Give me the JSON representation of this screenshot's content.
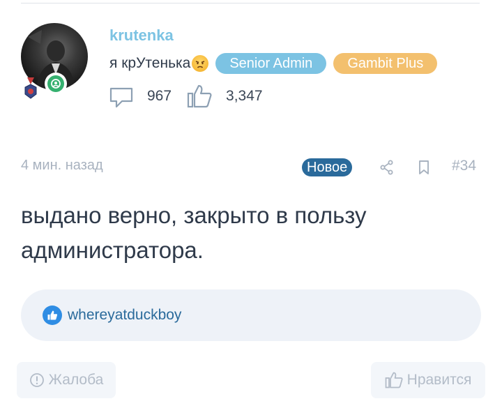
{
  "user": {
    "name": "krutenka",
    "status_text": "я крУтенька",
    "status_emoji": "angry-face-emoji",
    "badges": [
      {
        "label": "Senior Admin",
        "color": "#7cc3e3"
      },
      {
        "label": "Gambit Plus",
        "color": "#f3c06e"
      }
    ],
    "messages_count": "967",
    "likes_count": "3,347",
    "online": true
  },
  "post": {
    "time": "4 мин. назад",
    "new_label": "Новое",
    "number": "#34",
    "body": "выдано верно, закрыто в пользу администратора.",
    "liked_by": "whereyatduckboy"
  },
  "actions": {
    "report_label": "Жалоба",
    "like_label": "Нравится"
  },
  "colors": {
    "accent": "#7cc3e3",
    "new_badge": "#2a6a9b",
    "like_blue": "#2f8de4",
    "online_green": "#35b06f"
  }
}
